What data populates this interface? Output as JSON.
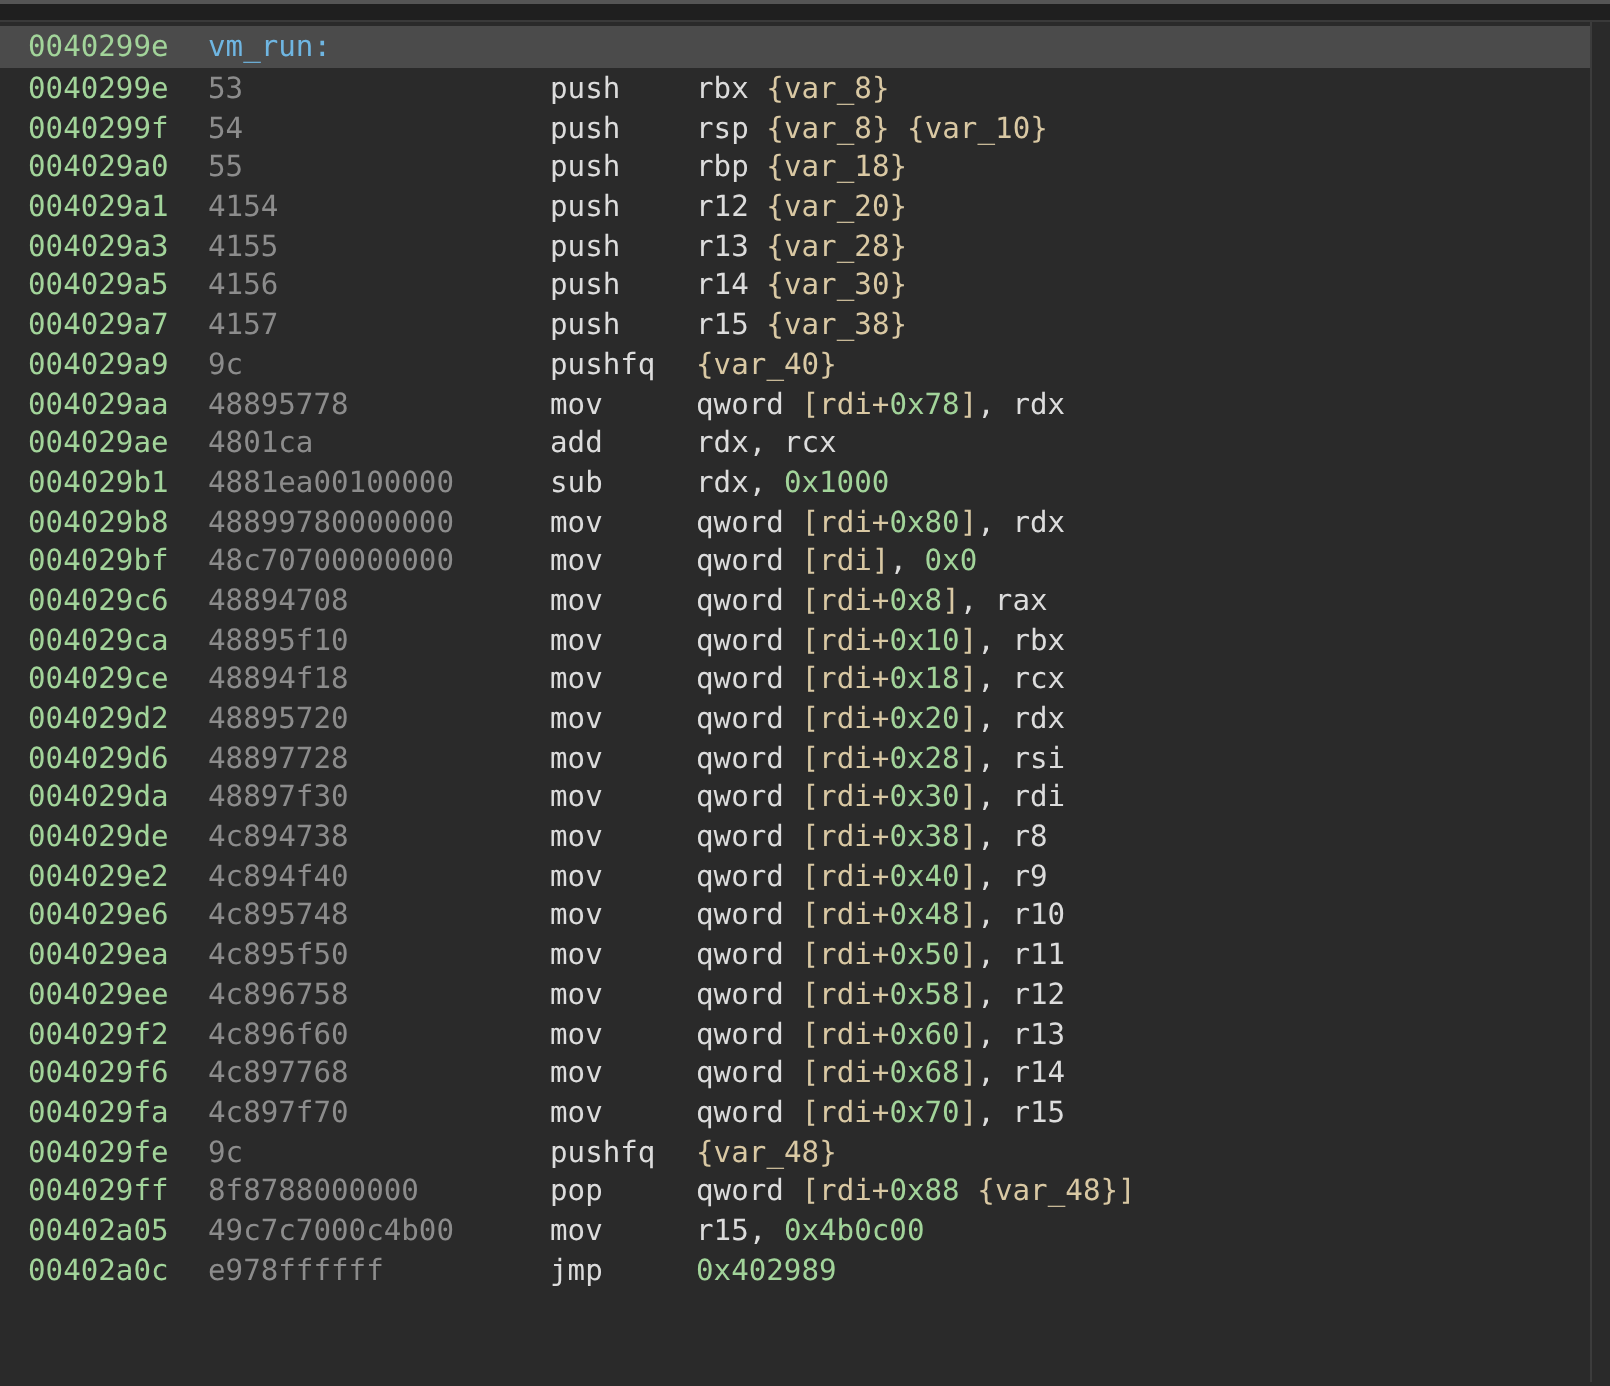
{
  "function": {
    "address": "0040299e",
    "name": "vm_run:"
  },
  "instructions": [
    {
      "address": "0040299e",
      "bytes": "53",
      "mnemonic": "push",
      "operands": "rbx {var_8}"
    },
    {
      "address": "0040299f",
      "bytes": "54",
      "mnemonic": "push",
      "operands": "rsp {var_8} {var_10}"
    },
    {
      "address": "004029a0",
      "bytes": "55",
      "mnemonic": "push",
      "operands": "rbp {var_18}"
    },
    {
      "address": "004029a1",
      "bytes": "4154",
      "mnemonic": "push",
      "operands": "r12 {var_20}"
    },
    {
      "address": "004029a3",
      "bytes": "4155",
      "mnemonic": "push",
      "operands": "r13 {var_28}"
    },
    {
      "address": "004029a5",
      "bytes": "4156",
      "mnemonic": "push",
      "operands": "r14 {var_30}"
    },
    {
      "address": "004029a7",
      "bytes": "4157",
      "mnemonic": "push",
      "operands": "r15 {var_38}"
    },
    {
      "address": "004029a9",
      "bytes": "9c",
      "mnemonic": "pushfq",
      "operands": "{var_40}"
    },
    {
      "address": "004029aa",
      "bytes": "48895778",
      "mnemonic": "mov",
      "operands": "qword [rdi+0x78], rdx"
    },
    {
      "address": "004029ae",
      "bytes": "4801ca",
      "mnemonic": "add",
      "operands": "rdx, rcx"
    },
    {
      "address": "004029b1",
      "bytes": "4881ea00100000",
      "mnemonic": "sub",
      "operands": "rdx, 0x1000"
    },
    {
      "address": "004029b8",
      "bytes": "48899780000000",
      "mnemonic": "mov",
      "operands": "qword [rdi+0x80], rdx"
    },
    {
      "address": "004029bf",
      "bytes": "48c70700000000",
      "mnemonic": "mov",
      "operands": "qword [rdi], 0x0"
    },
    {
      "address": "004029c6",
      "bytes": "48894708",
      "mnemonic": "mov",
      "operands": "qword [rdi+0x8], rax"
    },
    {
      "address": "004029ca",
      "bytes": "48895f10",
      "mnemonic": "mov",
      "operands": "qword [rdi+0x10], rbx"
    },
    {
      "address": "004029ce",
      "bytes": "48894f18",
      "mnemonic": "mov",
      "operands": "qword [rdi+0x18], rcx"
    },
    {
      "address": "004029d2",
      "bytes": "48895720",
      "mnemonic": "mov",
      "operands": "qword [rdi+0x20], rdx"
    },
    {
      "address": "004029d6",
      "bytes": "48897728",
      "mnemonic": "mov",
      "operands": "qword [rdi+0x28], rsi"
    },
    {
      "address": "004029da",
      "bytes": "48897f30",
      "mnemonic": "mov",
      "operands": "qword [rdi+0x30], rdi"
    },
    {
      "address": "004029de",
      "bytes": "4c894738",
      "mnemonic": "mov",
      "operands": "qword [rdi+0x38], r8"
    },
    {
      "address": "004029e2",
      "bytes": "4c894f40",
      "mnemonic": "mov",
      "operands": "qword [rdi+0x40], r9"
    },
    {
      "address": "004029e6",
      "bytes": "4c895748",
      "mnemonic": "mov",
      "operands": "qword [rdi+0x48], r10"
    },
    {
      "address": "004029ea",
      "bytes": "4c895f50",
      "mnemonic": "mov",
      "operands": "qword [rdi+0x50], r11"
    },
    {
      "address": "004029ee",
      "bytes": "4c896758",
      "mnemonic": "mov",
      "operands": "qword [rdi+0x58], r12"
    },
    {
      "address": "004029f2",
      "bytes": "4c896f60",
      "mnemonic": "mov",
      "operands": "qword [rdi+0x60], r13"
    },
    {
      "address": "004029f6",
      "bytes": "4c897768",
      "mnemonic": "mov",
      "operands": "qword [rdi+0x68], r14"
    },
    {
      "address": "004029fa",
      "bytes": "4c897f70",
      "mnemonic": "mov",
      "operands": "qword [rdi+0x70], r15"
    },
    {
      "address": "004029fe",
      "bytes": "9c",
      "mnemonic": "pushfq",
      "operands": "{var_48}"
    },
    {
      "address": "004029ff",
      "bytes": "8f8788000000",
      "mnemonic": "pop",
      "operands": "qword [rdi+0x88 {var_48}]"
    },
    {
      "address": "00402a05",
      "bytes": "49c7c7000c4b00",
      "mnemonic": "mov",
      "operands": "r15, 0x4b0c00"
    },
    {
      "address": "00402a0c",
      "bytes": "e978ffffff",
      "mnemonic": "jmp",
      "operands": "0x402989"
    }
  ]
}
